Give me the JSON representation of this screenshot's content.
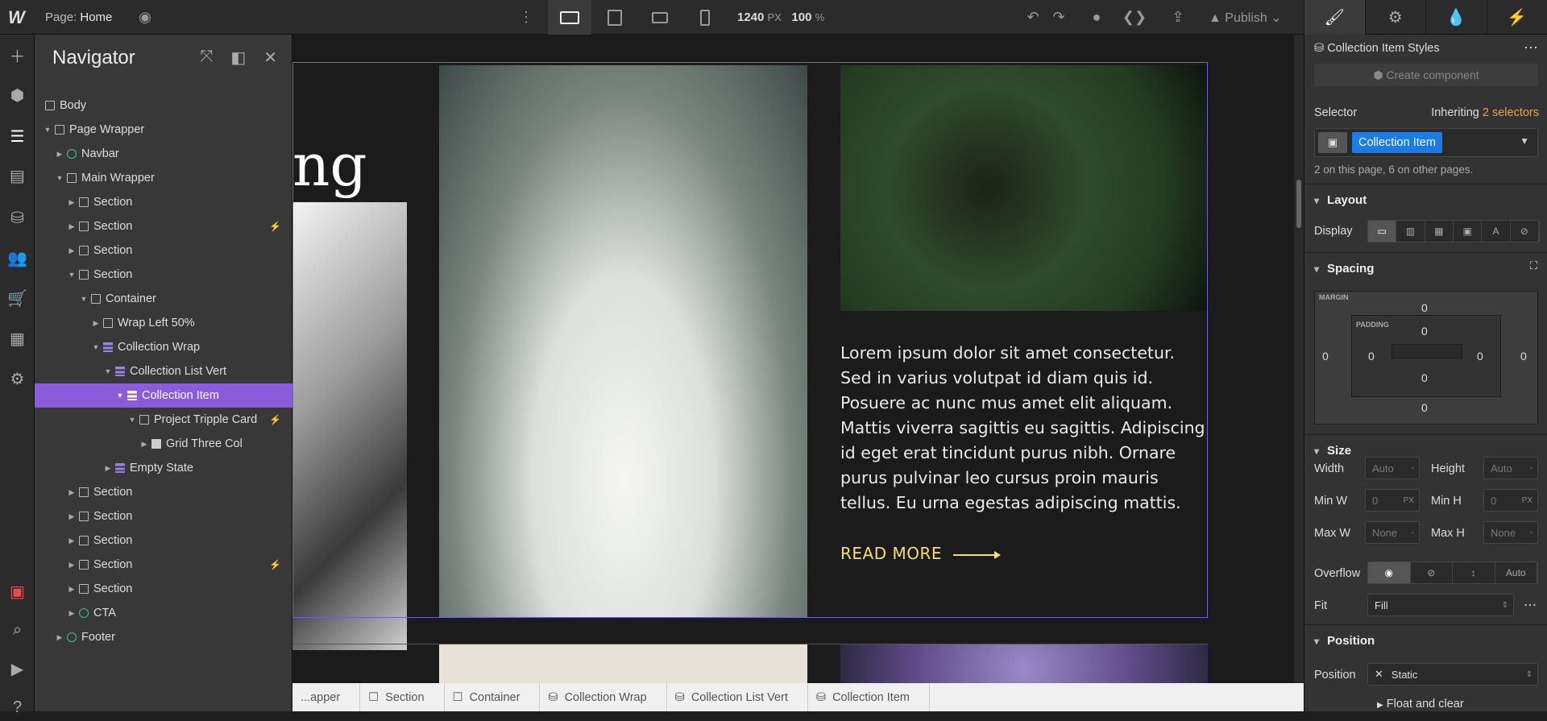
{
  "topbar": {
    "page_label": "Page:",
    "page_name": "Home",
    "width_value": "1240",
    "width_unit": "PX",
    "zoom_value": "100",
    "zoom_unit": "%",
    "publish_label": "Publish"
  },
  "navigator": {
    "title": "Navigator",
    "items": [
      {
        "label": "Body"
      },
      {
        "label": "Page Wrapper"
      },
      {
        "label": "Navbar"
      },
      {
        "label": "Main Wrapper"
      },
      {
        "label": "Section"
      },
      {
        "label": "Section"
      },
      {
        "label": "Section"
      },
      {
        "label": "Section"
      },
      {
        "label": "Container"
      },
      {
        "label": "Wrap Left 50%"
      },
      {
        "label": "Collection Wrap"
      },
      {
        "label": "Collection List Vert"
      },
      {
        "label": "Collection Item"
      },
      {
        "label": "Project Tripple Card"
      },
      {
        "label": "Grid Three Col"
      },
      {
        "label": "Empty State"
      },
      {
        "label": "Section"
      },
      {
        "label": "Section"
      },
      {
        "label": "Section"
      },
      {
        "label": "Section"
      },
      {
        "label": "Section"
      },
      {
        "label": "CTA"
      },
      {
        "label": "Footer"
      }
    ]
  },
  "canvas": {
    "heading_fragment": "ng",
    "body_text": "Lorem ipsum dolor sit amet consectetur. Sed in varius volutpat id diam quis id. Posuere ac nunc mus amet elit aliquam. Mattis viverra sagittis eu sagittis. Adipiscing id eget erat tincidunt purus nibh. Ornare purus pulvinar leo cursus proin mauris tellus. Eu urna egestas adipiscing mattis.",
    "read_more": "READ MORE",
    "accent_color": "#f3df6b",
    "selection_color": "#6e60d0"
  },
  "breadcrumbs": [
    "...apper",
    "Section",
    "Container",
    "Collection Wrap",
    "Collection List Vert",
    "Collection Item"
  ],
  "style_panel": {
    "title": "Collection Item Styles",
    "create_component": "Create component",
    "selector_label": "Selector",
    "inheriting_prefix": "Inheriting",
    "inheriting_count": "2 selectors",
    "selector_chip": "Collection Item",
    "selector_note": "2 on this page, 6 on other pages.",
    "layout_title": "Layout",
    "display_label": "Display",
    "spacing_title": "Spacing",
    "margin_label": "MARGIN",
    "padding_label": "PADDING",
    "margin": {
      "top": "0",
      "right": "0",
      "bottom": "0",
      "left": "0"
    },
    "padding": {
      "top": "0",
      "right": "0",
      "bottom": "0",
      "left": "0"
    },
    "size_title": "Size",
    "width_label": "Width",
    "width_value": "Auto",
    "height_label": "Height",
    "height_value": "Auto",
    "minw_label": "Min W",
    "minw_value": "0",
    "minh_label": "Min H",
    "minh_value": "0",
    "px_unit": "PX",
    "maxw_label": "Max W",
    "maxw_value": "None",
    "maxh_label": "Max H",
    "maxh_value": "None",
    "overflow_label": "Overflow",
    "overflow_auto": "Auto",
    "fit_label": "Fit",
    "fit_value": "Fill",
    "position_title": "Position",
    "position_label": "Position",
    "position_value": "Static",
    "float_clear": "Float and clear"
  }
}
